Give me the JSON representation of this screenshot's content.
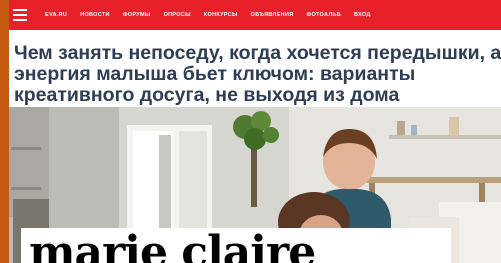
{
  "nav": {
    "items": [
      "EVA.RU",
      "НОВОСТИ",
      "ФОРУМЫ",
      "ОПРОСЫ",
      "КОНКУРСЫ",
      "ОБЪЯВЛЕНИЯ",
      "ФОТОАЛЬБ",
      "ВХОД"
    ]
  },
  "article": {
    "headline_lines": [
      "Чем занять непоседу, когда хочется передышки, а",
      "энергия малыша бьет ключом: варианты",
      "креативного досуга, не выходя из дома"
    ]
  },
  "brand": {
    "logo_text": "marie claire"
  },
  "colors": {
    "accent": "#e8202a",
    "border": "#c65a13",
    "headline": "#2f3d56"
  },
  "icons": {
    "menu": "hamburger-menu-icon"
  }
}
